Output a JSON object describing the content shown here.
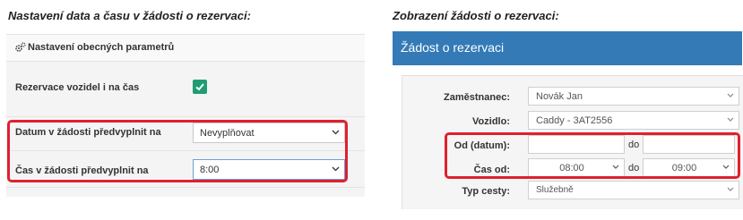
{
  "captions": {
    "left": "Nastavení data a času v žádosti o rezervaci:",
    "right": "Zobrazení žádosti o rezervaci:"
  },
  "settings_panel": {
    "header": {
      "icon": "gears-icon",
      "title": "Nastavení obecných parametrů"
    },
    "rows": {
      "vehicles_time": {
        "label": "Rezervace vozidel i na čas",
        "checked": true
      },
      "date_prefill": {
        "label": "Datum v žádosti předvyplnit na",
        "value": "Nevyplňovat"
      },
      "time_prefill": {
        "label": "Čas v žádosti předvyplnit na",
        "value": "8:00"
      }
    }
  },
  "request_form": {
    "title": "Žádost o rezervaci",
    "employee": {
      "label": "Zaměstnanec:",
      "value": "Novák Jan"
    },
    "vehicle": {
      "label": "Vozidlo:",
      "value": "Caddy - 3AT2556"
    },
    "date": {
      "label": "Od (datum):",
      "from_value": "",
      "separator": "do",
      "to_value": ""
    },
    "time": {
      "label": "Čas od:",
      "from_value": "08:00",
      "separator": "do",
      "to_value": "09:00"
    },
    "trip_type": {
      "label": "Typ cesty:",
      "value": "Služebně"
    }
  },
  "colors": {
    "highlight": "#e0202e",
    "header_blue": "#337ab7",
    "checkbox_green": "#1f9c72"
  }
}
